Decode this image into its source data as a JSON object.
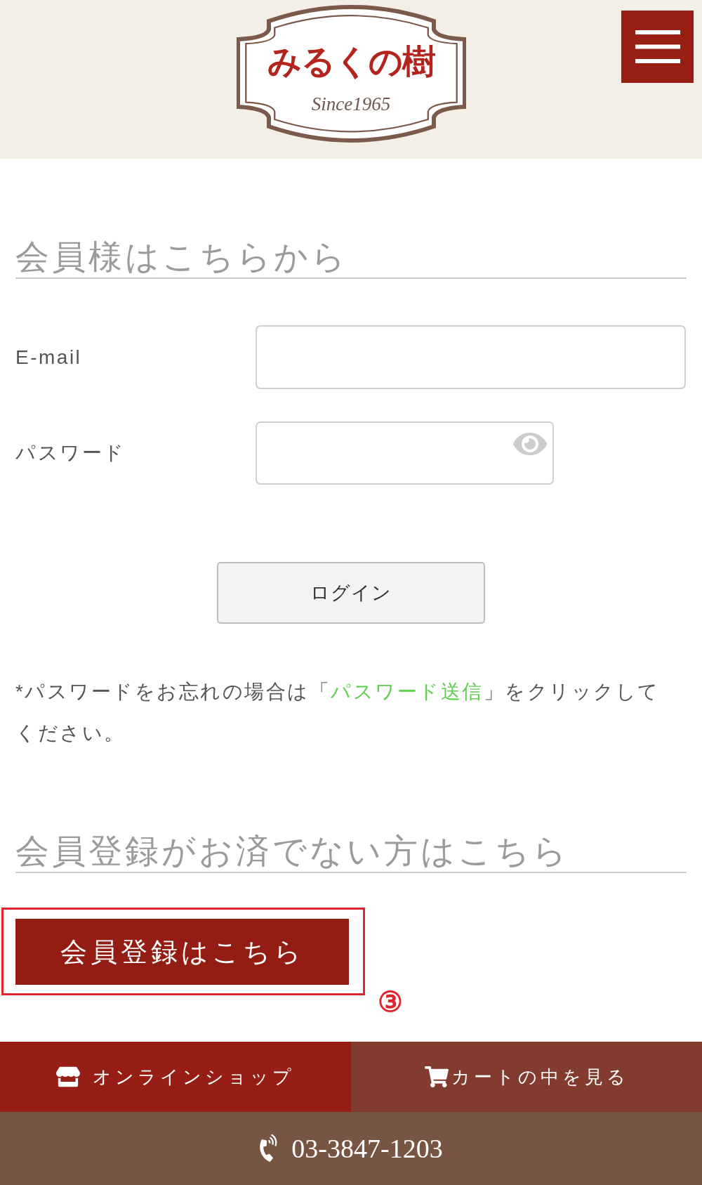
{
  "header": {
    "logo": {
      "name": "みるくの樹",
      "tagline": "Since1965"
    }
  },
  "login": {
    "heading": "会員様はこちらから",
    "fields": [
      {
        "label": "E-mail",
        "kind": "email"
      },
      {
        "label": "パスワード",
        "kind": "password"
      }
    ],
    "button": "ログイン",
    "note": {
      "before": "*パスワードをお忘れの場合は「",
      "link": "パスワード送信",
      "after": "」をクリックしてください。"
    }
  },
  "register": {
    "heading": "会員登録がお済でない方はこちら",
    "button": "会員登録はこちら",
    "annotation": "③"
  },
  "footer": {
    "links": [
      {
        "label": "オンラインショップ",
        "kind": "shop"
      },
      {
        "label": "カートの中を見る",
        "kind": "cart"
      }
    ],
    "phone": "03-3847-1203"
  }
}
